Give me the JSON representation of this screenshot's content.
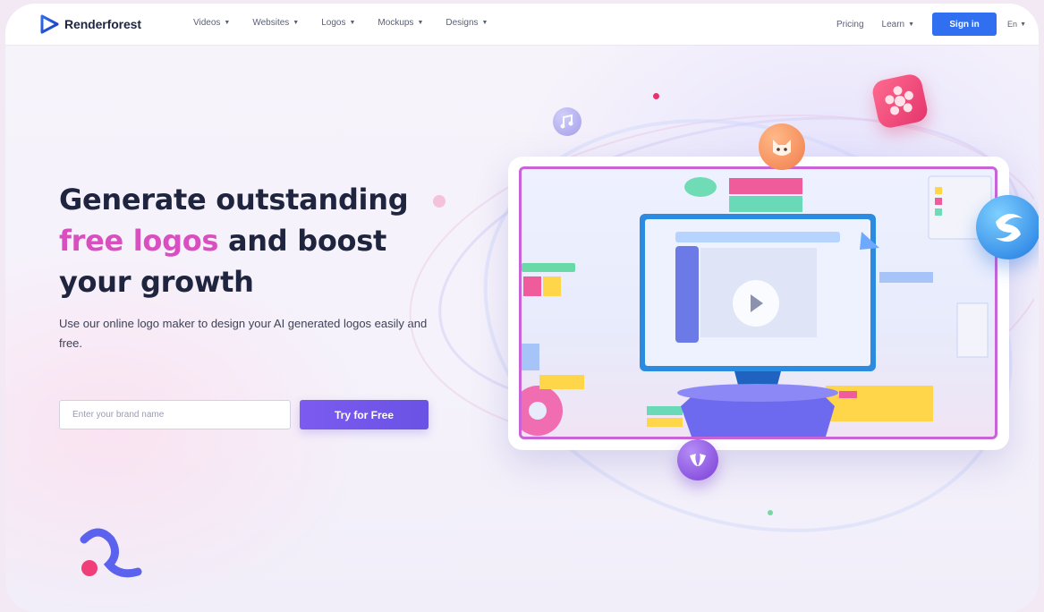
{
  "nav": {
    "brand": "Renderforest",
    "menu": [
      {
        "label": "Videos"
      },
      {
        "label": "Websites"
      },
      {
        "label": "Logos"
      },
      {
        "label": "Mockups"
      },
      {
        "label": "Designs"
      }
    ],
    "pricing": "Pricing",
    "learn": "Learn",
    "signin": "Sign in",
    "lang": "En"
  },
  "hero": {
    "headline_line1": "Generate outstanding",
    "headline_accent": "free logos",
    "headline_rest": " and boost",
    "headline_line3": "your growth",
    "subtext": "Use our online logo maker to design your AI generated logos easily and free.",
    "input_placeholder": "Enter your brand name",
    "cta": "Try for Free"
  },
  "colors": {
    "accent_pink": "#d94fc0",
    "primary_blue": "#2f6ff0",
    "cta_purple": "#7357ea",
    "heading": "#20253f"
  },
  "icons": {
    "logo": "renderforest-play-logo-icon",
    "caret": "caret-down-icon",
    "play": "play-icon"
  }
}
